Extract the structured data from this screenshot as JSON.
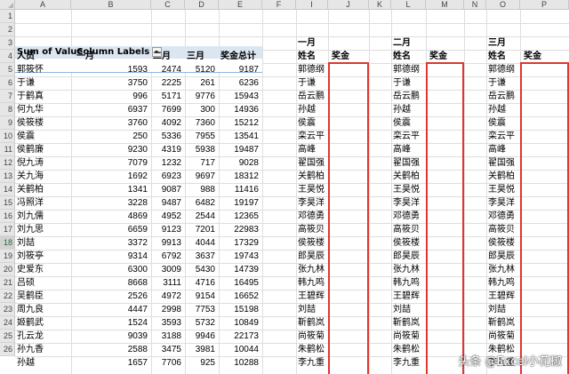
{
  "columns": [
    "A",
    "B",
    "C",
    "D",
    "E",
    "F",
    "I",
    "J",
    "K",
    "L",
    "M",
    "N",
    "O",
    "P"
  ],
  "row_numbers": [
    "1",
    "2",
    "3",
    "4",
    "5",
    "6",
    "7",
    "8",
    "9",
    "10",
    "11",
    "12",
    "13",
    "14",
    "15",
    "16",
    "17",
    "18",
    "19",
    "20",
    "21",
    "22",
    "23",
    "24",
    "25",
    "26"
  ],
  "selected_row": "18",
  "pivot": {
    "sum_label": "Sum of Value",
    "col_labels": "Column Labels",
    "row_field": "人员",
    "headers": [
      "一月",
      "二月",
      "三月",
      "奖金总计"
    ],
    "rows": [
      [
        "郭筱怀",
        "1593",
        "2474",
        "5120",
        "9187"
      ],
      [
        "于谦",
        "3750",
        "2225",
        "261",
        "6236"
      ],
      [
        "于鹤真",
        "996",
        "5171",
        "9776",
        "15943"
      ],
      [
        "何九华",
        "6937",
        "7699",
        "300",
        "14936"
      ],
      [
        "侯筱楼",
        "3760",
        "4092",
        "7360",
        "15212"
      ],
      [
        "侯震",
        "250",
        "5336",
        "7955",
        "13541"
      ],
      [
        "侯鹤廉",
        "9230",
        "4319",
        "5938",
        "19487"
      ],
      [
        "倪九涛",
        "7079",
        "1232",
        "717",
        "9028"
      ],
      [
        "关九海",
        "1692",
        "6923",
        "9697",
        "18312"
      ],
      [
        "关鹤柏",
        "1341",
        "9087",
        "988",
        "11416"
      ],
      [
        "冯照洋",
        "3228",
        "9487",
        "6482",
        "19197"
      ],
      [
        "刘九儒",
        "4869",
        "4952",
        "2544",
        "12365"
      ],
      [
        "刘九思",
        "6659",
        "9123",
        "7201",
        "22983"
      ],
      [
        "刘喆",
        "3372",
        "9913",
        "4044",
        "17329"
      ],
      [
        "刘筱亭",
        "9314",
        "6792",
        "3637",
        "19743"
      ],
      [
        "史爱东",
        "6300",
        "3009",
        "5430",
        "14739"
      ],
      [
        "吕硕",
        "8668",
        "3111",
        "4716",
        "16495"
      ],
      [
        "吴鹤臣",
        "2526",
        "4972",
        "9154",
        "16652"
      ],
      [
        "周九良",
        "4447",
        "2998",
        "7753",
        "15198"
      ],
      [
        "姬鹤武",
        "1524",
        "3593",
        "5732",
        "10849"
      ],
      [
        "孔云龙",
        "9039",
        "3188",
        "9946",
        "22173"
      ],
      [
        "孙九香",
        "2588",
        "3475",
        "3981",
        "10044"
      ],
      [
        "孙越",
        "1657",
        "7706",
        "925",
        "10288"
      ]
    ]
  },
  "blocks": [
    {
      "month": "一月",
      "name_label": "姓名",
      "bonus_label": "奖金",
      "names": [
        "郭德纲",
        "于谦",
        "岳云鹏",
        "孙越",
        "侯震",
        "栾云平",
        "高峰",
        "翟国强",
        "关鹤柏",
        "王昊悦",
        "李昊洋",
        "邓德勇",
        "高筱贝",
        "侯筱楼",
        "郎昊辰",
        "张九林",
        "韩九鸣",
        "王碧辉",
        "刘喆",
        "靳鹤岚",
        "尚筱菊",
        "朱鹤松",
        "李九重"
      ]
    },
    {
      "month": "二月",
      "name_label": "姓名",
      "bonus_label": "奖金",
      "names": [
        "郭德纲",
        "于谦",
        "岳云鹏",
        "孙越",
        "侯震",
        "栾云平",
        "高峰",
        "翟国强",
        "关鹤柏",
        "王昊悦",
        "李昊洋",
        "邓德勇",
        "高筱贝",
        "侯筱楼",
        "郎昊辰",
        "张九林",
        "韩九鸣",
        "王碧辉",
        "刘喆",
        "靳鹤岚",
        "尚筱菊",
        "朱鹤松",
        "李九重"
      ]
    },
    {
      "month": "三月",
      "name_label": "姓名",
      "bonus_label": "奖金",
      "names": [
        "郭德纲",
        "于谦",
        "岳云鹏",
        "孙越",
        "侯震",
        "栾云平",
        "高峰",
        "翟国强",
        "关鹤柏",
        "王昊悦",
        "李昊洋",
        "邓德勇",
        "高筱贝",
        "侯筱楼",
        "郎昊辰",
        "张九林",
        "韩九鸣",
        "王碧辉",
        "刘喆",
        "靳鹤岚",
        "尚筱菊",
        "朱鹤松",
        "李九重"
      ]
    }
  ],
  "watermark": "头条 @Excel小花椒",
  "colors": {
    "pivot_header_bg": "#dce6f1",
    "highlight_border": "#e0362e",
    "selected_row_text": "#1e6b3a"
  }
}
